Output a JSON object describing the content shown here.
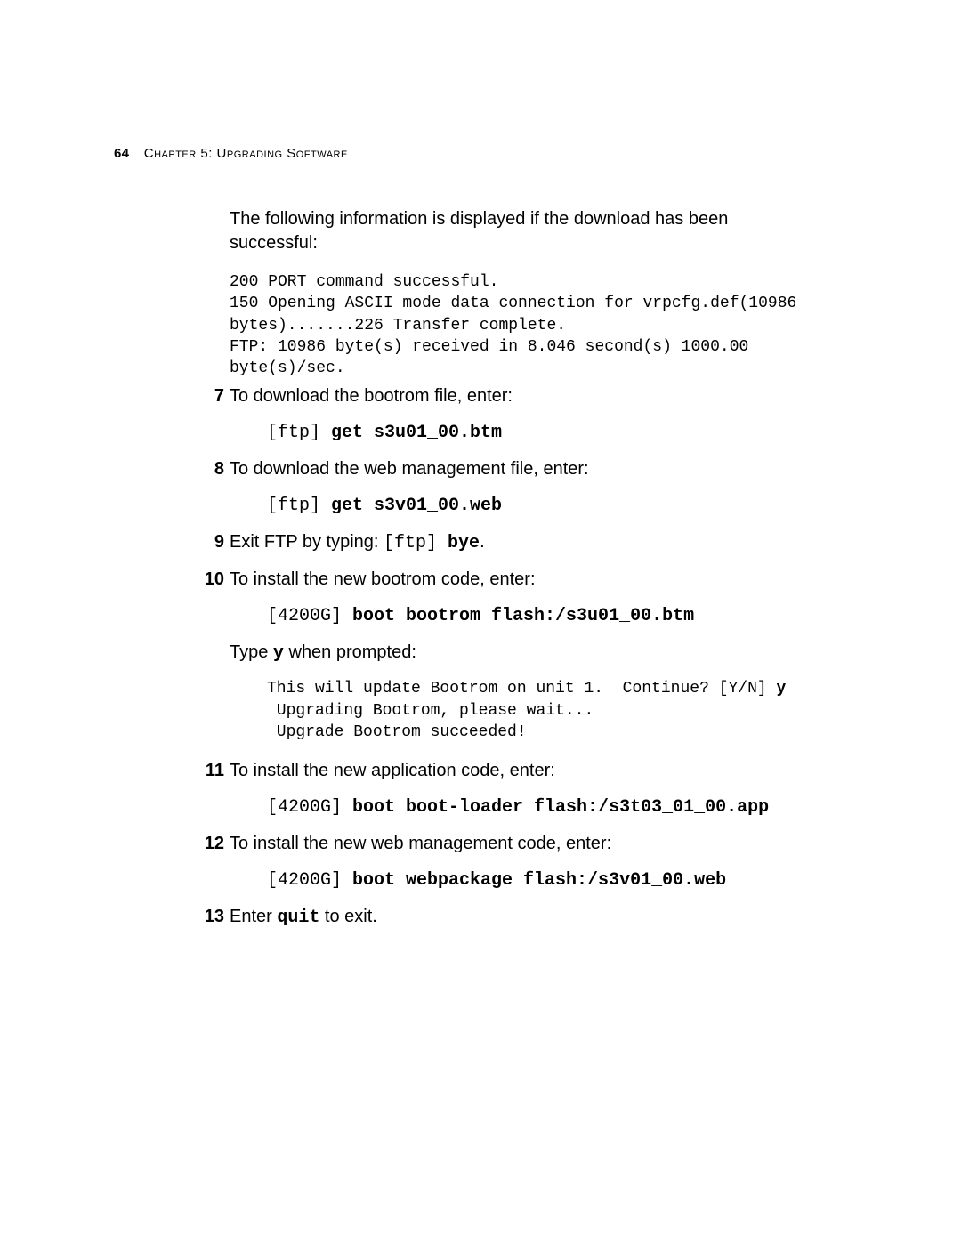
{
  "page_number": "64",
  "chapter_label": "Chapter 5: Upgrading Software",
  "intro": "The following information is displayed if the download has been successful:",
  "code_block_1": "200 PORT command successful.\n150 Opening ASCII mode data connection for vrpcfg.def(10986\nbytes).......226 Transfer complete.\nFTP: 10986 byte(s) received in 8.046 second(s) 1000.00\nbyte(s)/sec.",
  "step7": {
    "num": "7",
    "text": "To download the bootrom file, enter:",
    "cmd_prefix": "[ftp] ",
    "cmd_bold": "get s3u01_00.btm"
  },
  "step8": {
    "num": "8",
    "text": "To download the web management file, enter:",
    "cmd_prefix": "[ftp] ",
    "cmd_bold": "get s3v01_00.web"
  },
  "step9": {
    "num": "9",
    "pre": "Exit FTP by typing: ",
    "cmd_prefix": "[ftp]  ",
    "cmd_bold": "bye",
    "post": "."
  },
  "step10": {
    "num": "10",
    "text": "To install the new bootrom code, enter:",
    "cmd_prefix": "[4200G] ",
    "cmd_bold": "boot bootrom flash:/s3u01_00.btm",
    "type_text_pre": "Type ",
    "type_text_bold": "y",
    "type_text_post": " when prompted:",
    "output_pre": "This will update Bootrom on unit 1.  Continue? [Y/N] ",
    "output_bold": "y",
    "output_rest": "\n Upgrading Bootrom, please wait...\n Upgrade Bootrom succeeded!"
  },
  "step11": {
    "num": "11",
    "text": "To install the new application code, enter:",
    "cmd_prefix": "[4200G] ",
    "cmd_bold": "boot boot-loader flash:/s3t03_01_00.app"
  },
  "step12": {
    "num": "12",
    "text": "To install the new web management code, enter:",
    "cmd_prefix": "[4200G] ",
    "cmd_bold": "boot webpackage flash:/s3v01_00.web"
  },
  "step13": {
    "num": "13",
    "pre": "Enter ",
    "cmd_bold": "quit",
    "post": " to exit."
  }
}
